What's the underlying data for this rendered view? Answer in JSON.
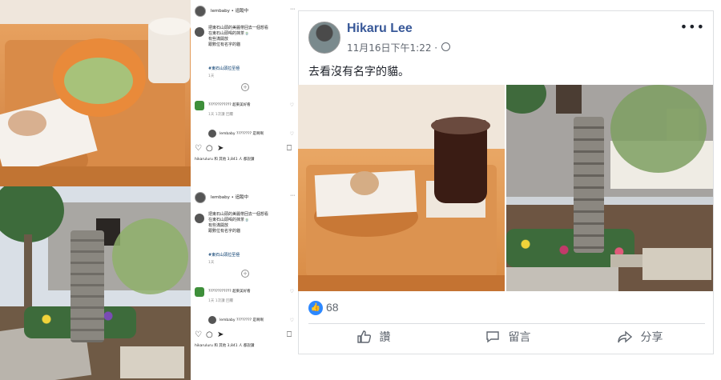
{
  "instagram": {
    "posts": [
      {
        "username": "lembaby • 追蹤中",
        "caption": "把東石山頭的美麗帶回去一個想看\n在東石山頭喝的抹茶🍵\n有些滿開放\n跟數位有名字的貓",
        "hashtag": "#東石山頭拉至極",
        "time": "1天",
        "comment1": "???????????? 超東美好看",
        "comment1_meta": "1天  1次讚  回覆",
        "comment2": "lembaby ???????? 是啊啊",
        "likes": "hikaruluru 和 其他 3,841 人 都說讚"
      },
      {
        "username": "lembaby • 追蹤中",
        "caption": "把東石山頭的美麗帶回去一個想看\n在東石山頭喝的抹茶🍵\n有些滿開放\n跟數位有名字的貓",
        "hashtag": "#東石山頭拉至極",
        "time": "1天",
        "comment1": "???????????? 超東美好看",
        "comment1_meta": "1天  1次讚  回覆",
        "comment2": "lembaby ???????? 是啊啊",
        "likes": "hikaruluru 和 其他 3,841 人 都說讚"
      }
    ]
  },
  "facebook": {
    "name": "Hikaru Lee",
    "timestamp": "11月16日下午1:22 ·",
    "text": "去看沒有名字的貓。",
    "like_count": "68",
    "actions": {
      "like": "讚",
      "comment": "留言",
      "share": "分享"
    },
    "more": "•••"
  },
  "colors": {
    "fb_blue": "#385898",
    "like_blue": "#2d88ff",
    "ig_link": "#00376b"
  }
}
